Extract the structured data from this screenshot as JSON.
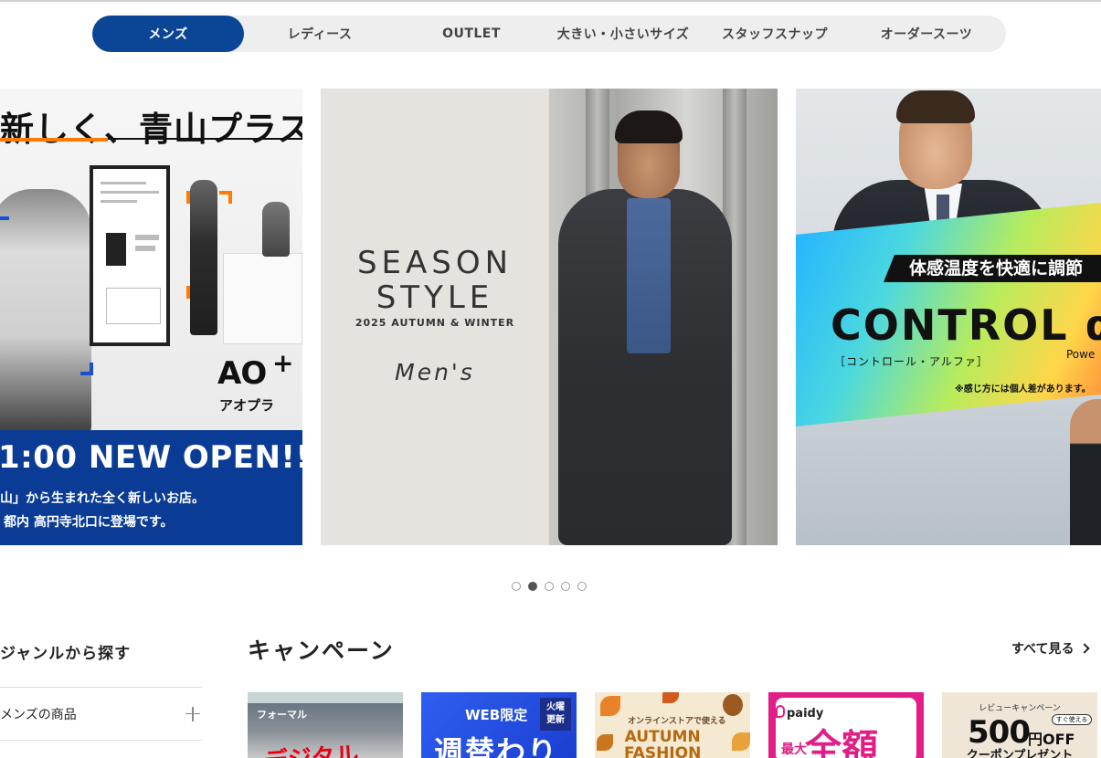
{
  "tabs": [
    {
      "label": "メンズ",
      "active": true
    },
    {
      "label": "レディース",
      "active": false
    },
    {
      "label": "OUTLET",
      "active": false
    },
    {
      "label": "大きい・小さいサイズ",
      "active": false
    },
    {
      "label": "スタッフスナップ",
      "active": false
    },
    {
      "label": "オーダースーツ",
      "active": false
    }
  ],
  "carousel": {
    "active_index": 1,
    "dot_count": 5,
    "slide1": {
      "headline": "新しく、青山プラス。",
      "logo": "AO",
      "logo_sub": "アオプラ",
      "open_text": "1:00 NEW OPEN!!",
      "sub1": "山」から生まれた全く新しいお店。",
      "sub2": "都内 高円寺北口に登場です。"
    },
    "slide2": {
      "season": "SEASON",
      "style": "STYLE",
      "subtitle": "2025 AUTUMN & WINTER",
      "mens": "Men's"
    },
    "slide3": {
      "label": "体感温度を快適に調節",
      "brand": "CONTROL α",
      "kana": "［コントロール・アルファ］",
      "power": "Powe",
      "note": "※感じ方には個人差があります。"
    }
  },
  "genre": {
    "title": "ジャンルから探す",
    "items": [
      {
        "label": "メンズの商品"
      }
    ]
  },
  "campaign": {
    "title": "キャンペーン",
    "see_all": "すべて見る",
    "cards": [
      {
        "tag": "フォーマル",
        "text": "デジタル"
      },
      {
        "web": "WEB限定",
        "badge1": "火曜",
        "badge2": "更新",
        "text": "週替わり"
      },
      {
        "small": "オンラインストアで使える",
        "big1": "AUTUMN",
        "big2": "FASHION"
      },
      {
        "brand": "paidy",
        "small": "最大",
        "big": "全額"
      },
      {
        "small": "レビューキャンペーン",
        "big": "500",
        "unit": "円OFF",
        "badge": "すぐ使える",
        "bottom": "クーポンプレゼント"
      }
    ]
  },
  "colors": {
    "brand_blue": "#0b4696",
    "open_banner": "#0a3c96",
    "accent_orange": "#ff7a00",
    "paidy_pink": "#e21d86"
  }
}
